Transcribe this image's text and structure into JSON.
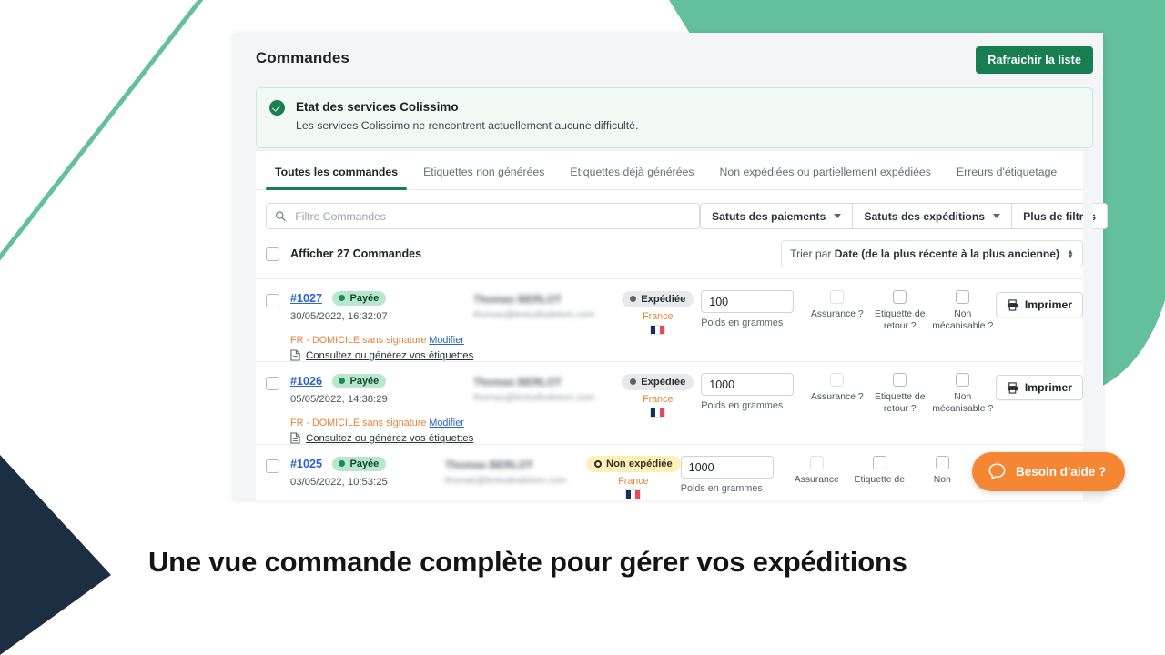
{
  "header": {
    "title": "Commandes",
    "refresh_label": "Rafraichir la liste"
  },
  "status_banner": {
    "icon": "check-circle-icon",
    "title": "Etat des services Colissimo",
    "subtitle": "Les services Colissimo ne rencontrent actuellement aucune difficulté."
  },
  "tabs": [
    {
      "label": "Toutes les commandes",
      "active": true
    },
    {
      "label": "Etiquettes non générées",
      "active": false
    },
    {
      "label": "Etiquettes déjà générées",
      "active": false
    },
    {
      "label": "Non expédiées ou partiellement expédiées",
      "active": false
    },
    {
      "label": "Erreurs d'étiquetage",
      "active": false
    }
  ],
  "filters": {
    "search_placeholder": "Filtre Commandes",
    "search_value": "",
    "search_icon": "search-icon",
    "payment_status_label": "Satuts des paiements",
    "shipping_status_label": "Satuts des expéditions",
    "more_filters_label": "Plus de filtres"
  },
  "select_all": {
    "label": "Afficher 27 Commandes",
    "checked": false
  },
  "sort": {
    "prefix": "Trier par ",
    "value": "Date (de la plus récente à la plus ancienne)"
  },
  "column_labels": {
    "weight": "Poids en grammes",
    "insurance": "Assurance ?",
    "return_label": "Etiquette de retour ?",
    "non_mechanizable": "Non mécanisable ?",
    "print": "Imprimer"
  },
  "orders": [
    {
      "id": "#1027",
      "payment_status": "Payée",
      "date": "30/05/2022, 16:32:07",
      "customer_name": "Thomas BERLOT",
      "customer_email": "thomas@lestudiodetom.com",
      "shipping_status": "Expédiée",
      "shipping_state": "sent",
      "country": "France",
      "weight": "100",
      "method": "FR - DOMICILE sans signature",
      "modify_label": "Modifier",
      "labels_link": "Consultez ou générez vos étiquettes",
      "insurance_checked": false,
      "insurance_disabled": true,
      "return_checked": false,
      "non_mech_checked": false,
      "print_label": "Imprimer"
    },
    {
      "id": "#1026",
      "payment_status": "Payée",
      "date": "05/05/2022, 14:38:29",
      "customer_name": "Thomas BERLOT",
      "customer_email": "thomas@lestudiodetom.com",
      "shipping_status": "Expédiée",
      "shipping_state": "sent",
      "country": "France",
      "weight": "1000",
      "method": "FR - DOMICILE sans signature",
      "modify_label": "Modifier",
      "labels_link": "Consultez ou générez vos étiquettes",
      "insurance_checked": false,
      "insurance_disabled": true,
      "return_checked": false,
      "non_mech_checked": false,
      "print_label": "Imprimer"
    },
    {
      "id": "#1025",
      "payment_status": "Payée",
      "date": "03/05/2022, 10:53:25",
      "customer_name": "Thomas BERLOT",
      "customer_email": "thomas@lestudiodetom.com",
      "shipping_status": "Non expédiée",
      "shipping_state": "pending",
      "country": "France",
      "weight": "1000",
      "method": "",
      "modify_label": "",
      "labels_link": "",
      "insurance_checked": false,
      "insurance_disabled": true,
      "return_checked": false,
      "non_mech_checked": false,
      "print_label": ""
    }
  ],
  "help": {
    "label": "Besoin d'aide ?",
    "icon": "chat-bubble-icon"
  },
  "caption": "Une vue commande complète pour gérer vos expéditions",
  "colors": {
    "brand_green": "#177e52",
    "accent_green": "#63bf9c",
    "navy": "#1c2e42",
    "orange": "#f58634",
    "link_blue": "#2e62c8",
    "badge_green_bg": "#b8e7cd",
    "badge_yellow_bg": "#fdf0b8"
  }
}
